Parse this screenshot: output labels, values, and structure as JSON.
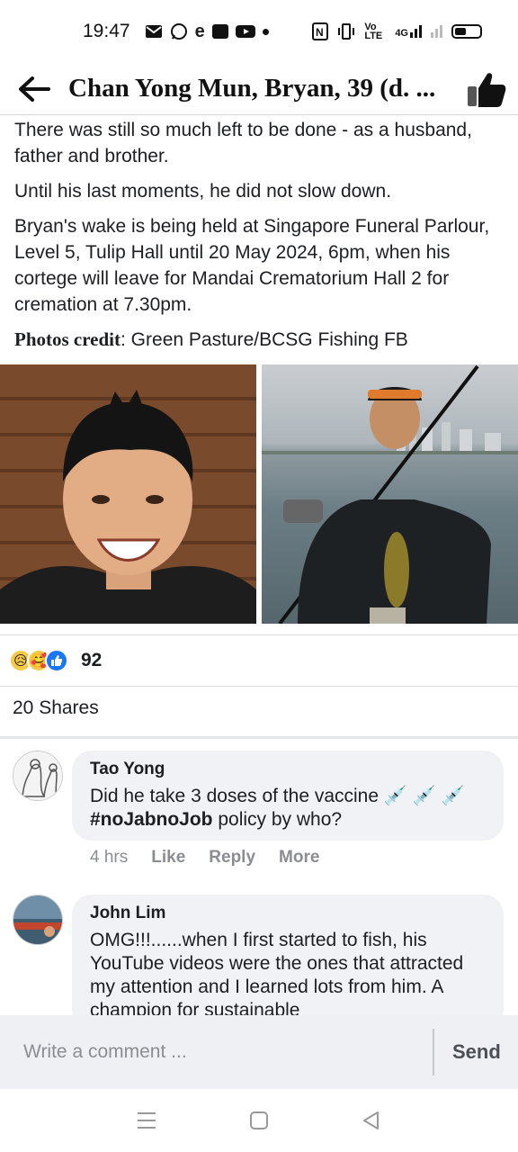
{
  "status_bar": {
    "time": "19:47",
    "lte_label": "Vo LTE",
    "net_label": "4G"
  },
  "header": {
    "title": "Chan Yong Mun, Bryan, 39 (d. ..."
  },
  "post": {
    "paragraph_1": "There was still so much left to be done - as a husband, father and brother.",
    "paragraph_2": "Until his last moments, he did not slow down.",
    "paragraph_3": "Bryan's wake is being held at Singapore Funeral Parlour, Level 5, Tulip Hall until 20 May 2024, 6pm, when his cortege will leave for Mandai Crematorium Hall 2 for cremation at 7.30pm.",
    "credit_label": "Photos credit",
    "credit_text": ": Green Pasture/BCSG Fishing FB"
  },
  "reactions": {
    "count": "92"
  },
  "shares": {
    "label": "20 Shares"
  },
  "comments": [
    {
      "name": "Tao Yong",
      "text_pre": "Did he take 3 doses of the vaccine 💉 💉 💉 ",
      "hashtag": "#noJabnoJob",
      "text_post": " policy by who?",
      "time": "4 hrs",
      "like": "Like",
      "reply": "Reply",
      "more": "More"
    },
    {
      "name": "John Lim",
      "text": "OMG!!!......when I first started to fish, his YouTube videos were the ones that attracted my attention and I learned lots from him. A champion for sustainable"
    }
  ],
  "composer": {
    "placeholder": "Write a comment ...",
    "send_label": "Send"
  },
  "colors": {
    "like_blue": "#1877f2",
    "bubble_bg": "#f0f2f5"
  }
}
